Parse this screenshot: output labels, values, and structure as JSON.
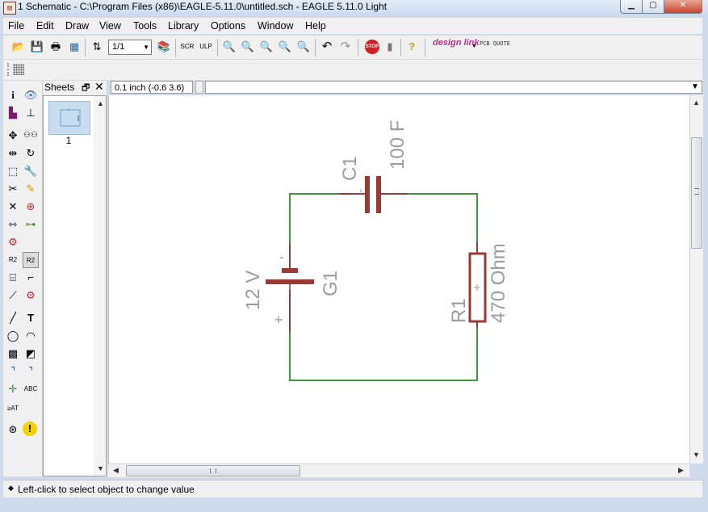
{
  "window": {
    "title": "1 Schematic - C:\\Program Files (x86)\\EAGLE-5.11.0\\untitled.sch - EAGLE 5.11.0 Light",
    "minimize_glyph": "▁",
    "maximize_glyph": "▢",
    "close_glyph": "✕"
  },
  "menu": [
    "File",
    "Edit",
    "Draw",
    "View",
    "Tools",
    "Library",
    "Options",
    "Window",
    "Help"
  ],
  "toolbar": {
    "zoom_value": "1/1",
    "stop_label": "STOP",
    "help_glyph": "?",
    "designlink_label": "design link",
    "pcbquote_label": "PCB QUOTE"
  },
  "sheets": {
    "title": "Sheets",
    "float_glyph": "🗗",
    "close_glyph": "✕",
    "items": [
      {
        "label": "1"
      }
    ]
  },
  "command_line": {
    "coordinate": "0.1 inch (-0.6 3.6)",
    "input_value": ""
  },
  "schematic": {
    "battery": {
      "name": "G1",
      "value": "12 V",
      "minus": "-",
      "plus": "+"
    },
    "capacitor": {
      "name": "C1",
      "value": "100 F"
    },
    "resistor": {
      "name": "R1",
      "value": "470 Ohm"
    },
    "colors": {
      "wire": "#3c9a3c",
      "part": "#9b3a34",
      "text": "#9c9c9c"
    }
  },
  "status": {
    "text": "Left-click to select object to change value"
  }
}
